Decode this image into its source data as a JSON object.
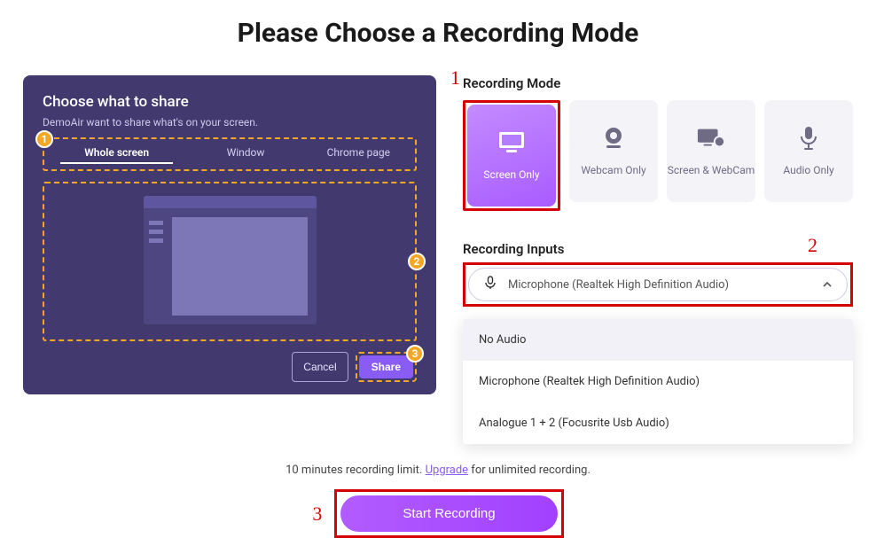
{
  "title": "Please Choose a Recording Mode",
  "share_panel": {
    "heading": "Choose what to share",
    "subtext": "DemoAir want to share what's on your screen.",
    "tabs": {
      "whole": "Whole screen",
      "window": "Window",
      "chrome": "Chrome page"
    },
    "badges": {
      "b1": "1",
      "b2": "2",
      "b3": "3"
    },
    "cancel": "Cancel",
    "share": "Share"
  },
  "annotations": {
    "n1": "1",
    "n2": "2",
    "n3": "3"
  },
  "modes": {
    "label": "Recording Mode",
    "screen_only": "Screen Only",
    "webcam_only": "Webcam Only",
    "screen_webcam": "Screen & WebCam",
    "audio_only": "Audio Only"
  },
  "inputs": {
    "label": "Recording Inputs",
    "selected": "Microphone (Realtek High Definition Audio)",
    "options": {
      "o0": "No Audio",
      "o1": "Microphone (Realtek High Definition Audio)",
      "o2": "Analogue 1 + 2 (Focusrite Usb Audio)"
    }
  },
  "footer": {
    "pre": "10 minutes recording limit. ",
    "link": "Upgrade",
    "post": " for unlimited recording."
  },
  "start": "Start Recording"
}
